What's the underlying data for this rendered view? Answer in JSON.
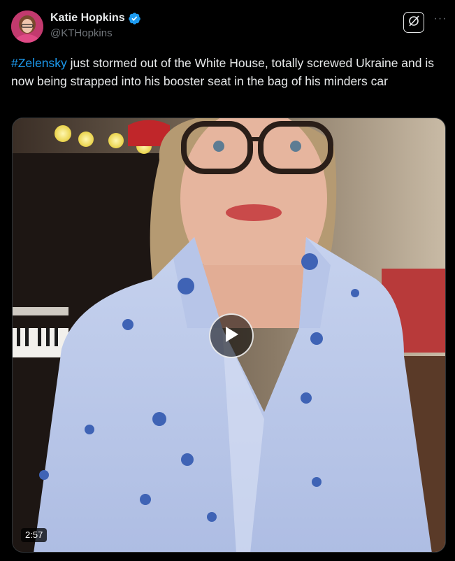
{
  "author": {
    "display_name": "Katie Hopkins",
    "handle": "@KTHopkins",
    "verified": true,
    "avatar_icon": "avatar"
  },
  "header_actions": {
    "grok_icon": "grok-icon",
    "more_icon": "more-icon",
    "more_glyph": "···"
  },
  "post": {
    "hashtag": "#Zelensky",
    "text": " just stormed out of the White House, totally screwed Ukraine and is now being strapped into his booster seat in the bag of his minders car"
  },
  "video": {
    "duration": "2:57",
    "play_icon": "play-icon"
  },
  "colors": {
    "background": "#000000",
    "text": "#e7e9ea",
    "secondary_text": "#71767b",
    "link": "#1d9bf0",
    "verified": "#1d9bf0"
  }
}
